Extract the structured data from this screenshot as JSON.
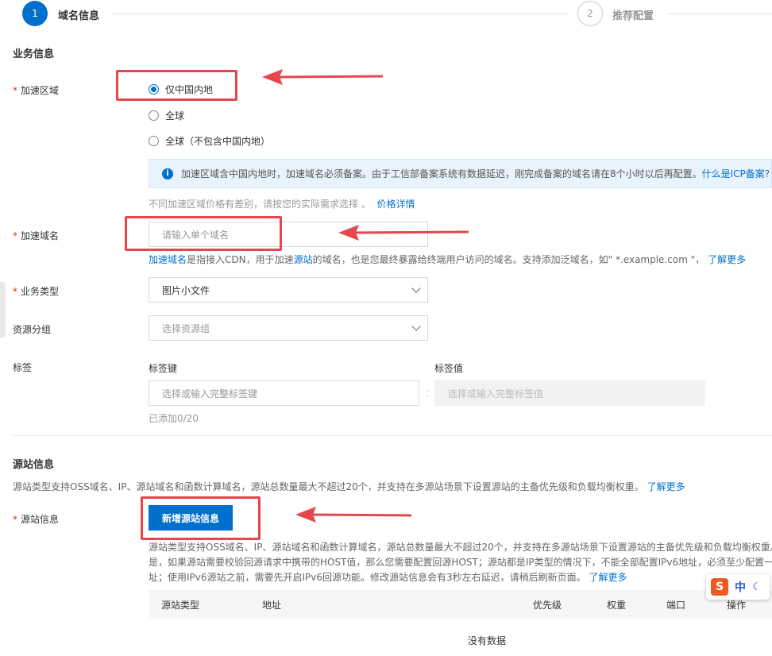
{
  "steps": [
    {
      "num": "1",
      "label": "域名信息"
    },
    {
      "num": "2",
      "label": "推荐配置"
    }
  ],
  "business": {
    "title": "业务信息",
    "region_label": "加速区域",
    "region_options": [
      "仅中国内地",
      "全球",
      "全球（不包含中国内地）"
    ],
    "region_selected": "仅中国内地",
    "info_icon": "info-icon",
    "info_text": "加速区域含中国内地时，加速域名必须备案。由于工信部备案系统有数据延迟，刚完成备案的域名请在8个小时以后再配置。",
    "info_link": "什么是ICP备案?",
    "price_hint": "不同加速区域价格有差别，请按您的实际需求选择 。",
    "price_link": "价格详情",
    "domain_label": "加速域名",
    "domain_placeholder": "请输入单个域名",
    "domain_help_link1": "加速域名",
    "domain_help_text1": "是指接入CDN，用于加速",
    "domain_help_link2": "源站",
    "domain_help_text2": "的域名，也是您最终暴露给终端用户访问的域名。支持添加泛域名，如\" *.example.com \"，",
    "domain_help_link3": "了解更多",
    "biz_type_label": "业务类型",
    "biz_type_value": "图片小文件",
    "rg_label": "资源分组",
    "rg_placeholder": "选择资源组",
    "tag_label": "标签",
    "tag_key_label": "标签键",
    "tag_key_placeholder": "选择或输入完整标签键",
    "tag_value_label": "标签值",
    "tag_value_placeholder": "选择或输入完整标签值",
    "tag_count": "已添加0/20"
  },
  "origin": {
    "title": "源站信息",
    "desc": "源站类型支持OSS域名、IP、源站域名和函数计算域名，源站总数量最大不超过20个，并支持在多源站场景下设置源站的主备优先级和负载均衡权重。",
    "desc_link": "了解更多",
    "label": "源站信息",
    "add_button": "新增源站信息",
    "note_line1": "源站类型支持OSS域名、IP、源站域名和函数计算域名，源站总数量最大不超过20个，并支持在多源站场景下设置源站的主备优先级和负载均衡权重。",
    "note_line2": "是，如果源站需要校验回源请求中携带的HOST值，那么您需要配置回源HOST；源站都是IP类型的情况下，不能全部配置IPv6地址，必须至少配置一",
    "note_line3": "址；使用IPv6源站之前，需要先开启IPv6回源功能。修改源站信息会有3秒左右延迟，请稍后刷新页面。",
    "note_link": "了解更多",
    "table_headers": [
      "源站类型",
      "地址",
      "优先级",
      "权重",
      "端口",
      "操作"
    ],
    "empty_text": "没有数据"
  },
  "ime": {
    "logo": "S",
    "mode": "中"
  }
}
